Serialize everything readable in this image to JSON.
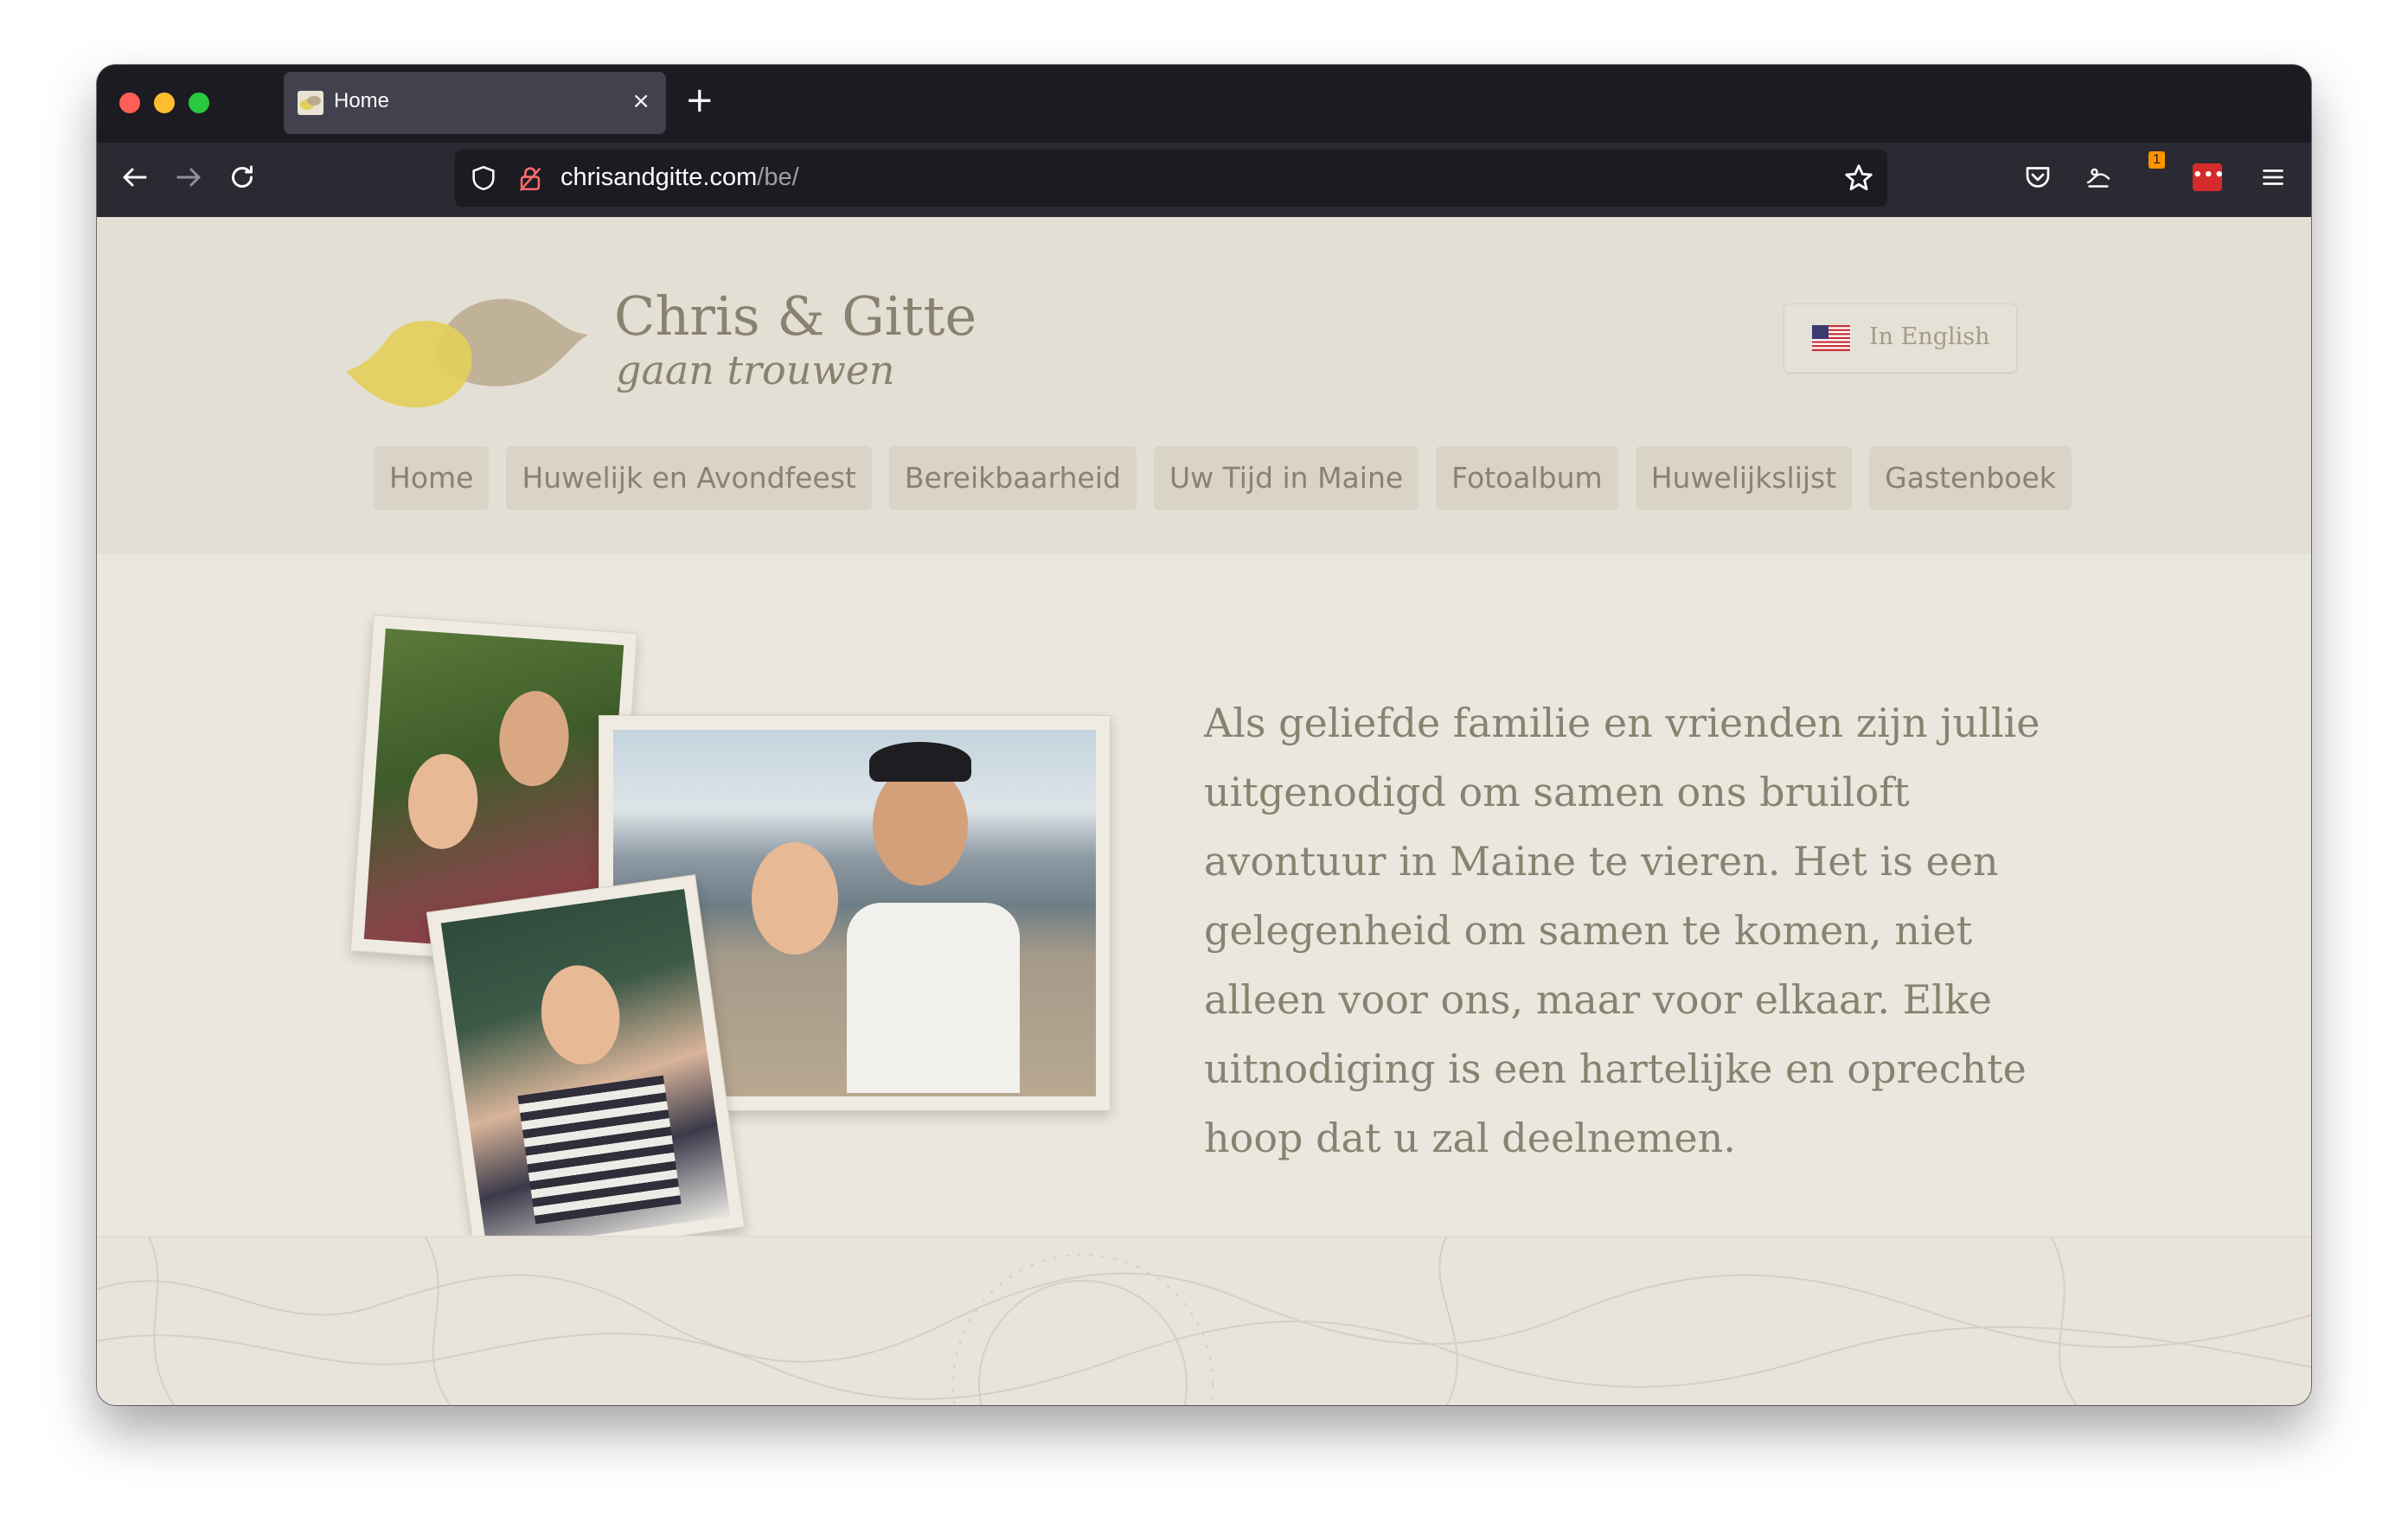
{
  "browser": {
    "tab_title": "Home",
    "tab_close": "×",
    "new_tab": "+",
    "url_host": "chrisandgitte.com",
    "url_path": "/be/",
    "extension_badge": "1",
    "extension_red_label": "•••"
  },
  "site": {
    "title": "Chris & Gitte",
    "subtitle": "gaan trouwen",
    "language_button": "In English",
    "colors": {
      "text": "#8a8270",
      "background": "#eae7df",
      "nav_bg": "#d9d4c7",
      "bird_yellow": "#e2cf5a",
      "bird_brown": "#b9aa8d"
    }
  },
  "nav": {
    "items": [
      {
        "label": "Home"
      },
      {
        "label": "Huwelijk en Avondfeest"
      },
      {
        "label": "Bereikbaarheid"
      },
      {
        "label": "Uw Tijd in Maine"
      },
      {
        "label": "Fotoalbum"
      },
      {
        "label": "Huwelijkslijst"
      },
      {
        "label": "Gastenboek"
      }
    ]
  },
  "main": {
    "intro": "Als geliefde familie en vrienden zijn jullie uitgenodigd om samen ons bruiloft avontuur in Maine te vieren. Het is een gelegenheid om samen te komen, niet alleen voor ons, maar voor elkaar. Elke uitnodiging is een hartelijke en oprechte hoop dat u zal deelnemen."
  },
  "icons": {
    "back": "arrow-left-icon",
    "forward": "arrow-right-icon",
    "reload": "reload-icon",
    "shield": "shield-icon",
    "lock": "lock-icon",
    "bookmark": "star-icon",
    "pocket": "pocket-icon",
    "extension": "extension-icon",
    "menu": "hamburger-menu-icon"
  }
}
